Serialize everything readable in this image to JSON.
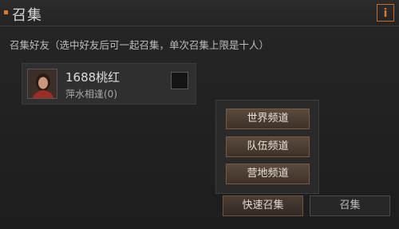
{
  "header": {
    "title": "召集",
    "info_label": "i"
  },
  "subtitle": "召集好友（选中好友后可一起召集，单次召集上限是十人）",
  "friends": [
    {
      "name": "1688桃红",
      "status": "萍水相逢(0)",
      "selected": false
    }
  ],
  "channel_menu": {
    "items": [
      {
        "label": "世界频道"
      },
      {
        "label": "队伍频道"
      },
      {
        "label": "营地频道"
      }
    ]
  },
  "actions": {
    "quick_summon": "快速召集",
    "summon": "召集"
  },
  "colors": {
    "accent": "#e07a2a",
    "button_border": "#7a5a40"
  }
}
